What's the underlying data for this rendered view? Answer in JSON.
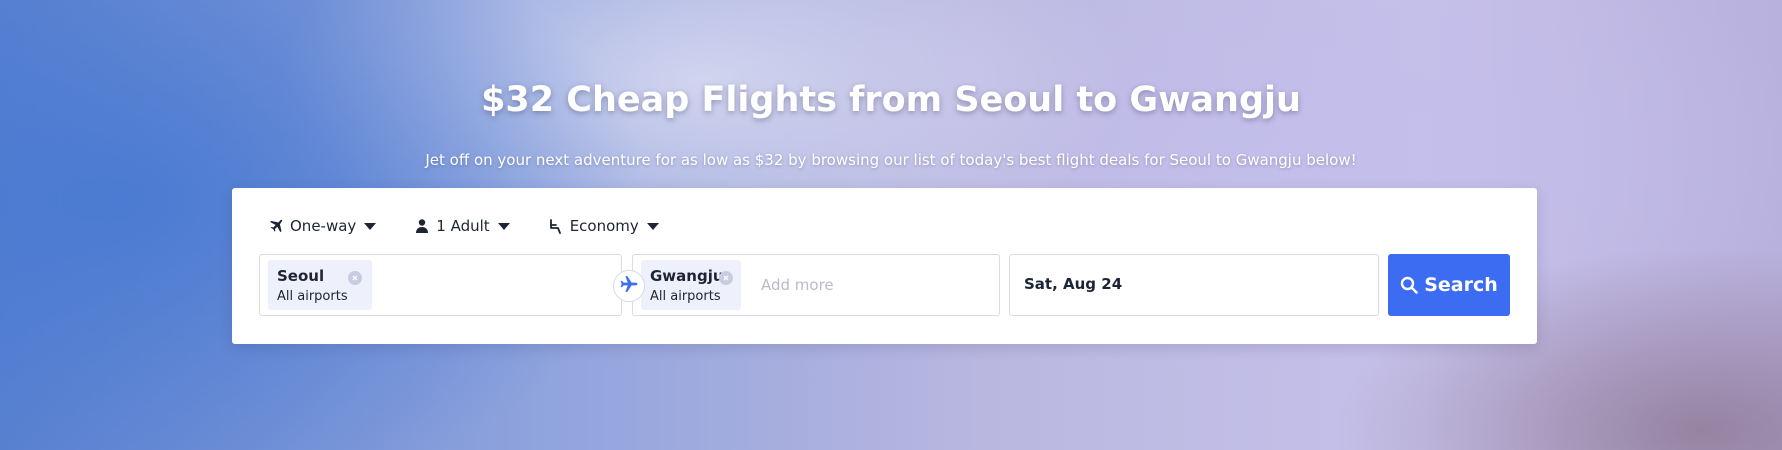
{
  "hero": {
    "title": "$32 Cheap Flights from Seoul to Gwangju",
    "subtitle": "Jet off on your next adventure for as low as $32 by browsing our list of today's best flight deals for Seoul to Gwangju below!"
  },
  "search_form": {
    "trip_type": {
      "label": "One-way",
      "icon": "plane-icon"
    },
    "travelers": {
      "label": "1 Adult",
      "icon": "person-icon"
    },
    "cabin_class": {
      "label": "Economy",
      "icon": "seat-icon"
    },
    "origin": {
      "city": "Seoul",
      "detail": "All airports"
    },
    "destination": {
      "city": "Gwangju",
      "detail": "All airports",
      "placeholder": "Add more"
    },
    "date": {
      "value": "Sat, Aug 24"
    },
    "search_button": {
      "label": "Search",
      "icon": "search-icon"
    },
    "swap_icon": "plane-swap-icon"
  },
  "colors": {
    "accent": "#3c6cf2",
    "chip_bg": "#eef0fb",
    "text": "#1d2433"
  }
}
